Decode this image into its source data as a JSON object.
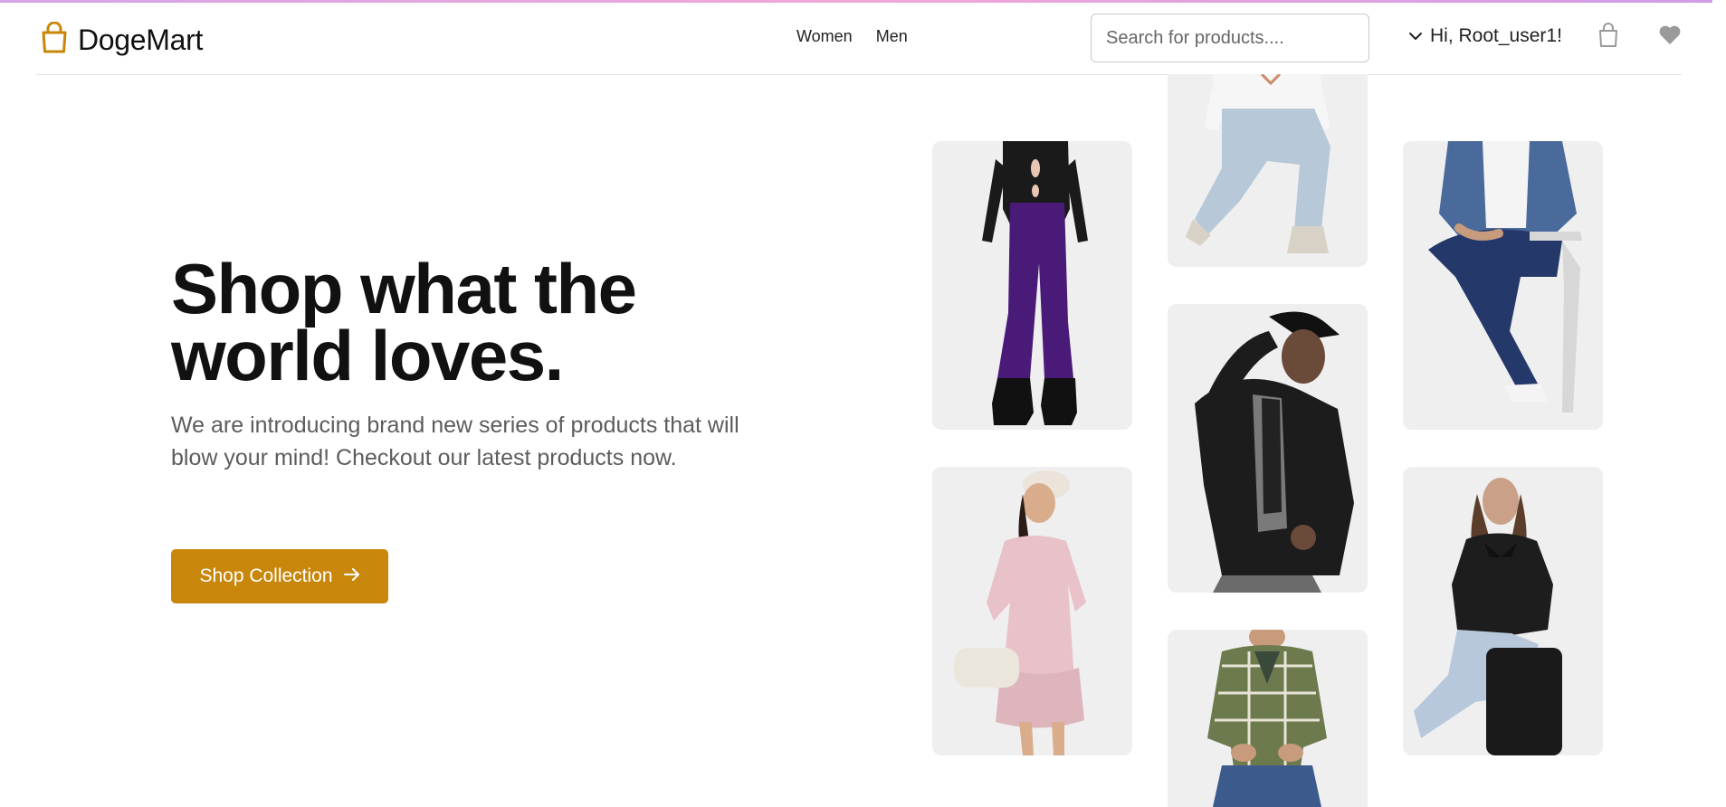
{
  "header": {
    "brand": "DogeMart",
    "nav": [
      {
        "label": "Women"
      },
      {
        "label": "Men"
      }
    ],
    "search": {
      "placeholder": "Search for products....",
      "value": ""
    },
    "user_greeting": "Hi, Root_user1!",
    "icons": {
      "logo": "shopping-bag-icon",
      "user_menu": "chevron-down-icon",
      "cart": "shopping-bag-icon",
      "wishlist": "heart-icon"
    }
  },
  "hero": {
    "title": "Shop what the world loves.",
    "description": "We are introducing brand new series of products that will blow your mind! Checkout our latest products now.",
    "cta_label": "Shop Collection",
    "cta_icon": "arrow-right-icon"
  },
  "gallery": [
    {
      "subject": "woman-purple-jeans"
    },
    {
      "subject": "woman-light-jeans-crouching"
    },
    {
      "subject": "man-denim-shirt-sitting"
    },
    {
      "subject": "woman-pink-dress"
    },
    {
      "subject": "man-leather-jacket-cap"
    },
    {
      "subject": "woman-leather-jacket-sitting"
    },
    {
      "subject": "man-plaid-shirt"
    }
  ],
  "colors": {
    "brand": "#c8870a",
    "text": "#111111",
    "muted": "#5c5c5c",
    "border": "#e3e3e3"
  }
}
